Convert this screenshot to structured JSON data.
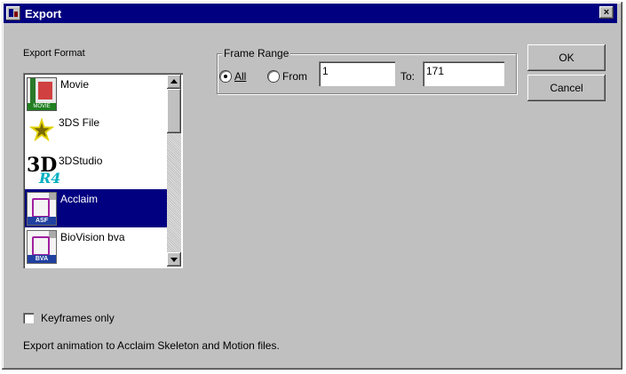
{
  "window": {
    "title": "Export",
    "close_glyph": "×"
  },
  "export_format": {
    "label": "Export Format",
    "items": [
      {
        "label": "Movie",
        "icon": "movie-icon",
        "tag": "MOVIE",
        "selected": false
      },
      {
        "label": "3DS File",
        "icon": "3ds-file-icon",
        "selected": false
      },
      {
        "label": "3DStudio",
        "icon": "3dstudio-icon",
        "big": "3D",
        "sub": "R4",
        "selected": false
      },
      {
        "label": "Acclaim",
        "icon": "acclaim-icon",
        "tag": "ASF",
        "selected": true
      },
      {
        "label": "BioVision bva",
        "icon": "biovision-icon",
        "tag": "BVA",
        "selected": false
      }
    ]
  },
  "frame_range": {
    "label": "Frame Range",
    "all_label": "All",
    "from_label": "From",
    "to_label": "To:",
    "from_value": "1",
    "to_value": "171",
    "selected_option": "All"
  },
  "buttons": {
    "ok": "OK",
    "cancel": "Cancel"
  },
  "keyframes_only": {
    "label": "Keyframes only",
    "checked": false
  },
  "status": "Export animation to Acclaim Skeleton and Motion files."
}
